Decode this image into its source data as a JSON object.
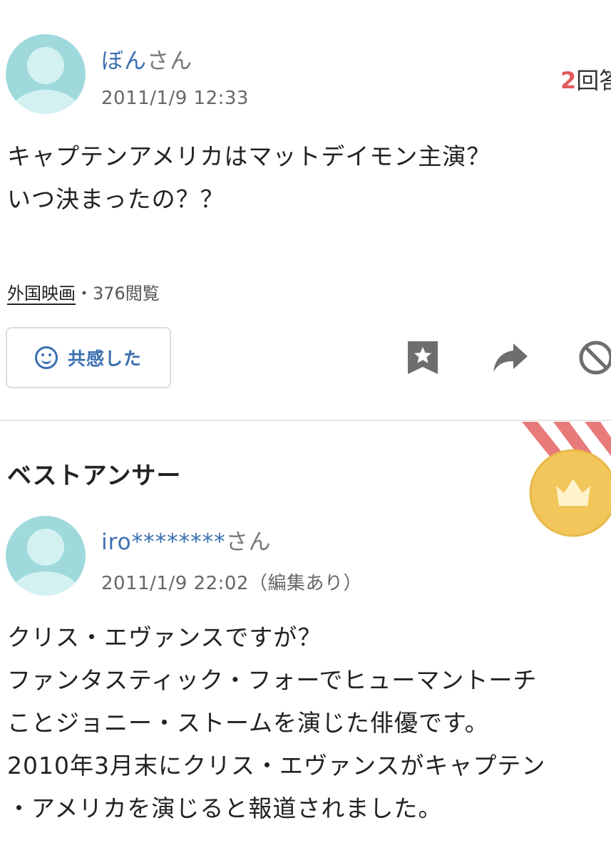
{
  "question": {
    "user": {
      "name": "ぼん",
      "suffix": "さん"
    },
    "timestamp": "2011/1/9 12:33",
    "answers": {
      "count": "2",
      "label": "回答"
    },
    "lines": [
      "キャプテンアメリカはマットデイモン主演？",
      "いつ決まったの？？"
    ],
    "category": "外国映画",
    "separator": "・",
    "views": "376閲覧",
    "empathy_label": "共感した"
  },
  "icons": {
    "smile": "smile-icon",
    "bookmark": "bookmark-star-icon",
    "share": "share-arrow-icon",
    "block": "prohibited-icon",
    "medal": "gold-crown-medal-icon",
    "avatar": "default-user-avatar"
  },
  "colors": {
    "link_blue": "#3a6fb0",
    "accent_red": "#e05a5a",
    "avatar_teal": "#9fd9dc",
    "medal_gold": "#f2c65a",
    "ribbon_red": "#e97a7a"
  },
  "best_answer": {
    "title": "ベストアンサー",
    "user": {
      "name": "iro********",
      "suffix": "さん"
    },
    "timestamp": "2011/1/9 22:02（編集あり）",
    "lines": [
      "クリス・エヴァンスですが？",
      "ファンタスティック・フォーでヒューマントーチ",
      "ことジョニー・ストームを演じた俳優です。",
      "2010年3月末にクリス・エヴァンスがキャプテン",
      "・アメリカを演じると報道されました。"
    ]
  }
}
